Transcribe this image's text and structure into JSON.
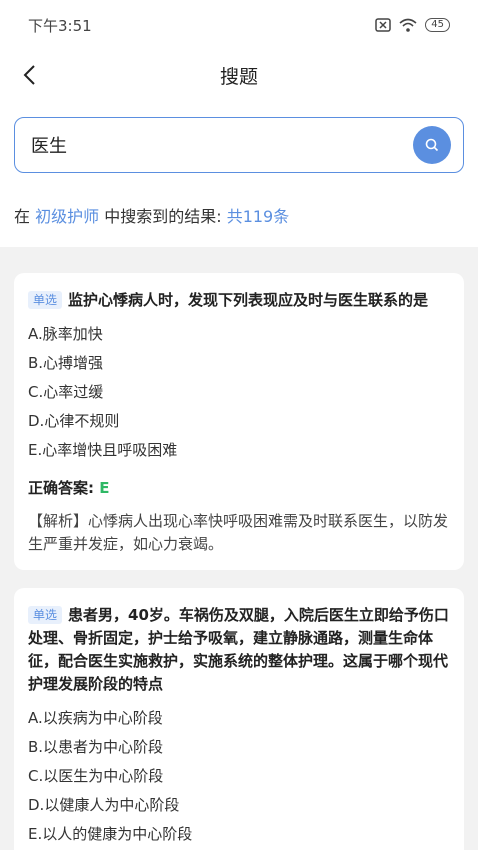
{
  "status_bar": {
    "time": "下午3:51",
    "battery": "45"
  },
  "nav": {
    "title": "搜题"
  },
  "search": {
    "value": "医生"
  },
  "result": {
    "prefix": "在 ",
    "category": "初级护师",
    "middle": " 中搜索到的结果: ",
    "count": "共119条"
  },
  "questions": [
    {
      "tag": "单选",
      "title": "监护心悸病人时，发现下列表现应及时与医生联系的是",
      "options": [
        "A.脉率加快",
        "B.心搏增强",
        "C.心率过缓",
        "D.心律不规则",
        "E.心率增快且呼吸困难"
      ],
      "answer_label": "正确答案: ",
      "answer": "E",
      "analysis": "【解析】心悸病人出现心率快呼吸困难需及时联系医生，以防发生严重并发症，如心力衰竭。"
    },
    {
      "tag": "单选",
      "title": "患者男，40岁。车祸伤及双腿，入院后医生立即给予伤口处理、骨折固定，护士给予吸氧，建立静脉通路，测量生命体征，配合医生实施救护，实施系统的整体护理。这属于哪个现代护理发展阶段的特点",
      "options": [
        "A.以疾病为中心阶段",
        "B.以患者为中心阶段",
        "C.以医生为中心阶段",
        "D.以健康人为中心阶段",
        "E.以人的健康为中心阶段"
      ]
    }
  ]
}
